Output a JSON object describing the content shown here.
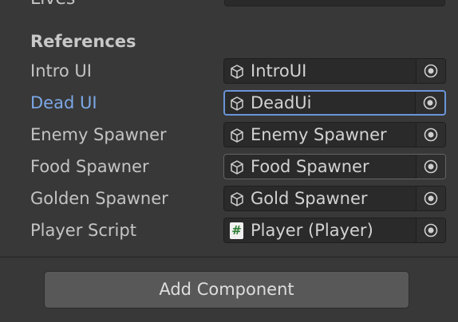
{
  "partial_row": {
    "label": "Lives"
  },
  "section": {
    "title": "References"
  },
  "fields": [
    {
      "label": "Intro UI",
      "value": "IntroUI",
      "icon": "gameobject-icon",
      "state": "normal"
    },
    {
      "label": "Dead UI",
      "value": "DeadUi",
      "icon": "gameobject-icon",
      "state": "selected"
    },
    {
      "label": "Enemy Spawner",
      "value": "Enemy Spawner",
      "icon": "gameobject-icon",
      "state": "normal"
    },
    {
      "label": "Food Spawner",
      "value": "Food Spawner",
      "icon": "gameobject-icon",
      "state": "hover"
    },
    {
      "label": "Golden Spawner",
      "value": "Gold Spawner",
      "icon": "gameobject-icon",
      "state": "normal"
    },
    {
      "label": "Player Script",
      "value": "Player (Player)",
      "icon": "script-icon",
      "icon_glyph": "#",
      "state": "normal"
    }
  ],
  "footer": {
    "add_component_label": "Add Component"
  },
  "colors": {
    "background": "#383838",
    "field_bg": "#2a2a2a",
    "label_text": "#c4c4c4",
    "active_label": "#7ca7e6",
    "selected_border": "#6a95d9",
    "button_bg": "#585858",
    "script_icon_hash": "#2f7d33"
  }
}
